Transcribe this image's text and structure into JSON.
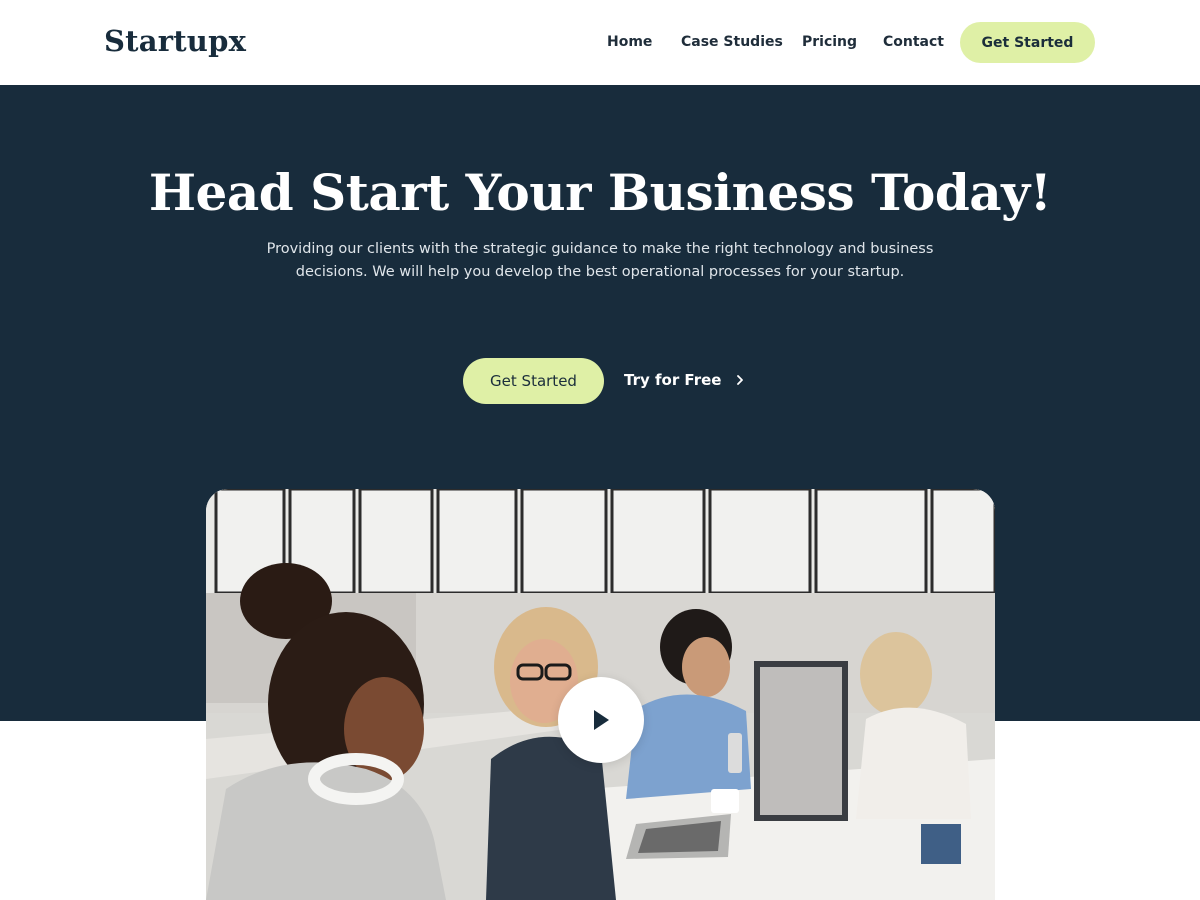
{
  "header": {
    "logo": "Startupx",
    "nav": [
      "Home",
      "Case Studies",
      "Pricing",
      "Contact"
    ],
    "cta_label": "Get Started"
  },
  "hero": {
    "title": "Head Start Your Business Today!",
    "subtitle_line1": "Providing our clients with the strategic guidance to make the right technology and business",
    "subtitle_line2": "decisions. We will help you develop the best operational processes for your startup.",
    "primary_cta": "Get Started",
    "secondary_cta": "Try for Free"
  },
  "media": {
    "icon": "play-icon",
    "description_icon": "chevron-right-icon"
  },
  "colors": {
    "brand_dark": "#182c3c",
    "accent": "#dff0a6",
    "white": "#ffffff"
  }
}
